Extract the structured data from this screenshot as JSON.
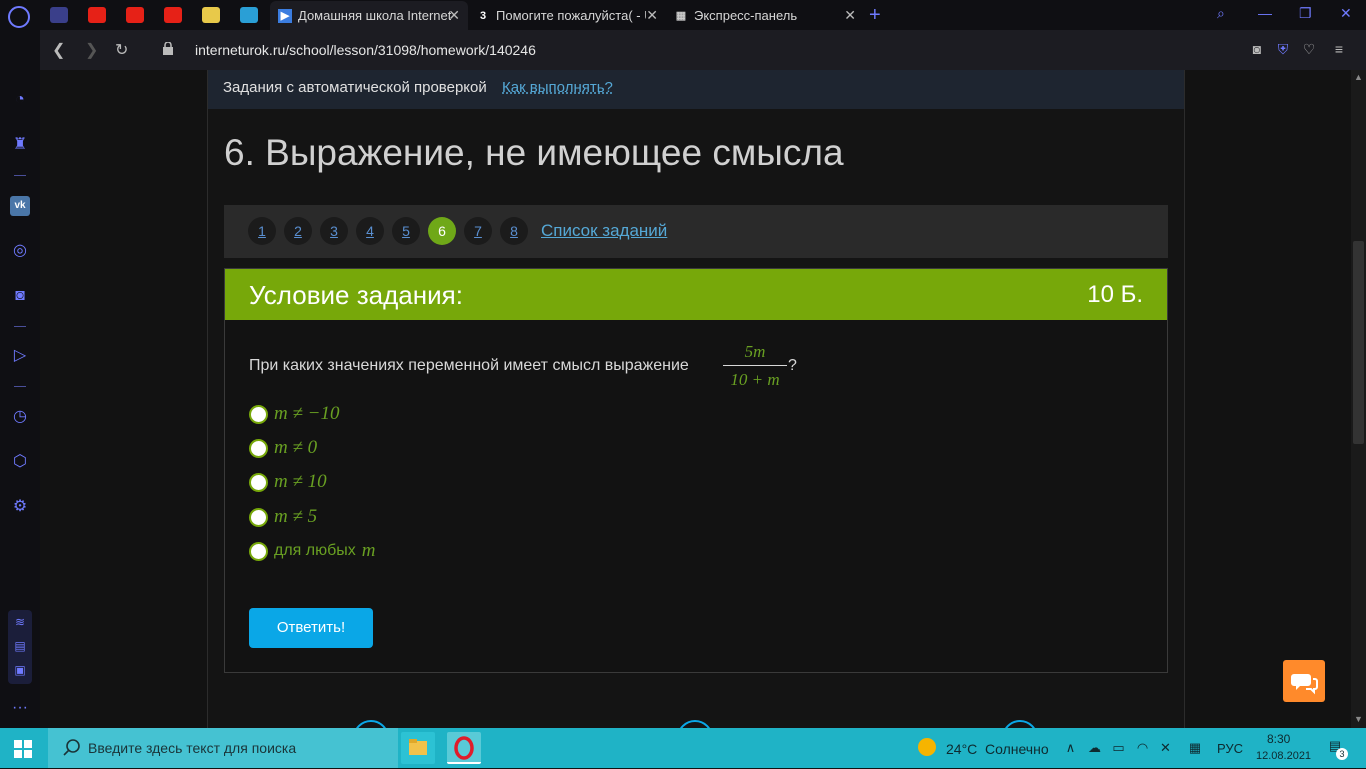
{
  "browser": {
    "tabs": [
      {
        "label": "Домашняя школа Internet",
        "active": true
      },
      {
        "label": "Помогите пожалуйста( - U",
        "active": false
      },
      {
        "label": "Экспресс-панель",
        "active": false
      }
    ],
    "tab2_fav": "3",
    "url": "interneturok.ru/school/lesson/31098/homework/140246"
  },
  "page": {
    "autobar_text": "Задания с автоматической проверкой",
    "autobar_link": "Как выполнять?",
    "title": "6. Выражение, не имеющее смысла",
    "pager": [
      "1",
      "2",
      "3",
      "4",
      "5",
      "6",
      "7",
      "8"
    ],
    "pager_active": "6",
    "task_list_link": "Список заданий",
    "task_header": "Условие задания:",
    "points": "10 Б.",
    "question": "При каких значениях переменной имеет смысл выражение",
    "fraction": {
      "numerator": "5m",
      "denominator": "10 + m"
    },
    "question_end": "?",
    "options": [
      "m ≠ −10",
      "m ≠ 0",
      "m ≠ 10",
      "m ≠ 5"
    ],
    "option_last_text": "для любых",
    "option_last_var": "m",
    "answer_button": "Ответить!"
  },
  "taskbar": {
    "search_placeholder": "Введите здесь текст для поиска",
    "weather_temp": "24°C",
    "weather_desc": "Солнечно",
    "lang": "РУС",
    "time": "8:30",
    "date": "12.08.2021",
    "notif_count": "3"
  },
  "colors": {
    "accent_green": "#77a80a",
    "button_blue": "#0aa7e7",
    "opera_blue": "#6f7aff",
    "taskbar": "#1fb3c6"
  }
}
